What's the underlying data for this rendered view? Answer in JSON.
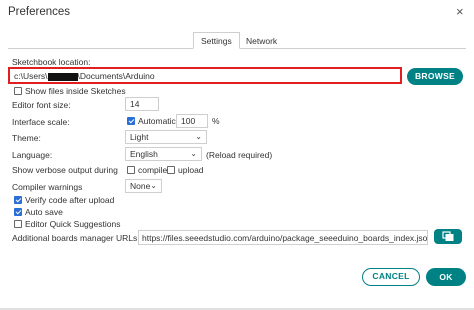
{
  "window": {
    "title": "Preferences",
    "close_glyph": "×"
  },
  "tabs": [
    {
      "label": "Settings",
      "active": true
    },
    {
      "label": "Network",
      "active": false
    }
  ],
  "sketchbook": {
    "label": "Sketchbook location:",
    "path_prefix": "c:\\Users\\",
    "path_suffix": "\\Documents\\Arduino",
    "browse_label": "BROWSE",
    "show_files_label": "Show files inside Sketches",
    "show_files_checked": false
  },
  "editor_font_size": {
    "label": "Editor font size:",
    "value": "14"
  },
  "interface_scale": {
    "label": "Interface scale:",
    "automatic_label": "Automatic",
    "automatic_checked": true,
    "value": "100",
    "unit": "%"
  },
  "theme": {
    "label": "Theme:",
    "value": "Light"
  },
  "language": {
    "label": "Language:",
    "value": "English",
    "note": "(Reload required)"
  },
  "verbose": {
    "label": "Show verbose output during",
    "compile_label": "compile",
    "compile_checked": false,
    "upload_label": "upload",
    "upload_checked": false
  },
  "compiler_warnings": {
    "label": "Compiler warnings",
    "value": "None"
  },
  "verify_code": {
    "label": "Verify code after upload",
    "checked": true
  },
  "auto_save": {
    "label": "Auto save",
    "checked": true
  },
  "quick_suggestions": {
    "label": "Editor Quick Suggestions",
    "checked": false
  },
  "boards_manager": {
    "label": "Additional boards manager URLs:",
    "value": "https://files.seeedstudio.com/arduino/package_seeeduino_boards_index.json,..."
  },
  "footer": {
    "cancel_label": "CANCEL",
    "ok_label": "OK"
  },
  "colors": {
    "accent": "#008184",
    "highlight_border": "#e02020",
    "checkbox_on": "#2a6fd6"
  },
  "icons": {
    "close": "close-icon",
    "chevron": "chevron-down-icon",
    "url_edit": "open-window-icon"
  }
}
